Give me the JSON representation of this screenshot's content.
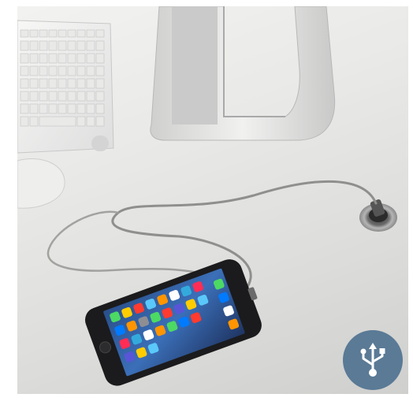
{
  "image": {
    "description_free": true
  },
  "badge": {
    "icon": "usb-icon",
    "color": "#5a7a96"
  }
}
